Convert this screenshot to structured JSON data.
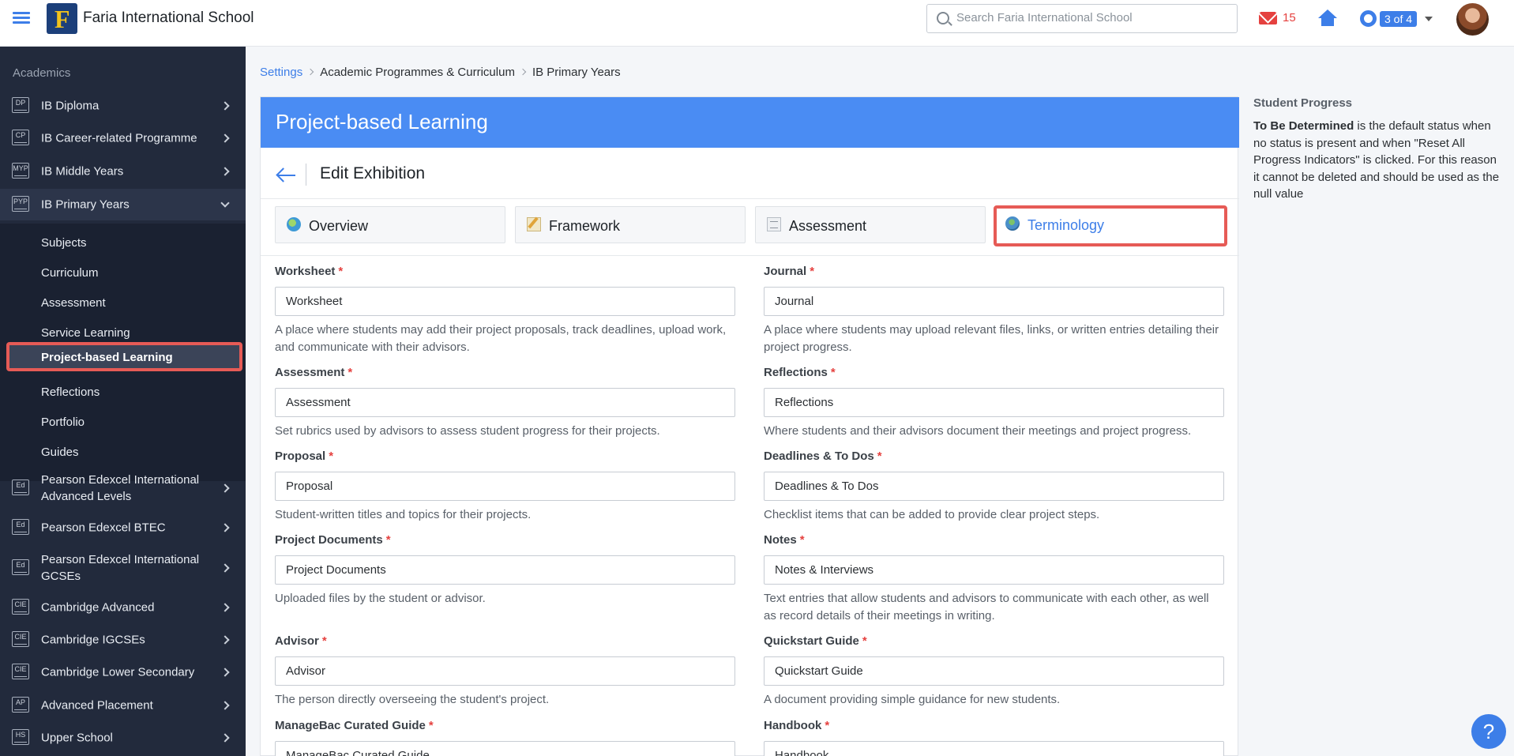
{
  "header": {
    "school_name": "Faria International School",
    "search_placeholder": "Search Faria International School",
    "mail_count": "15",
    "help_count": "3 of 4",
    "logo_letter": "F"
  },
  "sidebar": {
    "section": "Academics",
    "programmes_top": [
      {
        "abbr": "DP",
        "label": "IB Diploma"
      },
      {
        "abbr": "CP",
        "label": "IB Career-related Programme"
      },
      {
        "abbr": "MYP",
        "label": "IB Middle Years"
      },
      {
        "abbr": "PYP",
        "label": "IB Primary Years"
      }
    ],
    "sub_items": [
      "Subjects",
      "Curriculum",
      "Assessment",
      "Service Learning",
      "Project-based Learning",
      "Reflections",
      "Portfolio",
      "Guides"
    ],
    "programmes_bottom": [
      {
        "abbr": "Ed",
        "label": "Pearson Edexcel International Advanced Levels"
      },
      {
        "abbr": "Ed",
        "label": "Pearson Edexcel BTEC"
      },
      {
        "abbr": "Ed",
        "label": "Pearson Edexcel International GCSEs"
      },
      {
        "abbr": "CIE",
        "label": "Cambridge Advanced"
      },
      {
        "abbr": "CIE",
        "label": "Cambridge IGCSEs"
      },
      {
        "abbr": "CIE",
        "label": "Cambridge Lower Secondary"
      },
      {
        "abbr": "AP",
        "label": "Advanced Placement"
      },
      {
        "abbr": "HS",
        "label": "Upper School"
      }
    ]
  },
  "breadcrumb": [
    "Settings",
    "Academic Programmes & Curriculum",
    "IB Primary Years"
  ],
  "card": {
    "title": "Project-based Learning",
    "subtitle": "Edit Exhibition",
    "tabs": [
      "Overview",
      "Framework",
      "Assessment",
      "Terminology"
    ]
  },
  "fields": [
    {
      "label": "Worksheet",
      "value": "Worksheet",
      "help": "A place where students may add their project proposals, track deadlines, upload work, and communicate with their advisors."
    },
    {
      "label": "Journal",
      "value": "Journal",
      "help": "A place where students may upload relevant files, links, or written entries detailing their project progress."
    },
    {
      "label": "Assessment",
      "value": "Assessment",
      "help": "Set rubrics used by advisors to assess student progress for their projects."
    },
    {
      "label": "Reflections",
      "value": "Reflections",
      "help": "Where students and their advisors document their meetings and project progress."
    },
    {
      "label": "Proposal",
      "value": "Proposal",
      "help": "Student-written titles and topics for their projects."
    },
    {
      "label": "Deadlines & To Dos",
      "value": "Deadlines & To Dos",
      "help": "Checklist items that can be added to provide clear project steps."
    },
    {
      "label": "Project Documents",
      "value": "Project Documents",
      "help": "Uploaded files by the student or advisor."
    },
    {
      "label": "Notes",
      "value": "Notes & Interviews",
      "help": "Text entries that allow students and advisors to communicate with each other, as well as record details of their meetings in writing."
    },
    {
      "label": "Advisor",
      "value": "Advisor",
      "help": "The person directly overseeing the student's project."
    },
    {
      "label": "Quickstart Guide",
      "value": "Quickstart Guide",
      "help": "A document providing simple guidance for new students."
    },
    {
      "label": "ManageBac Curated Guide",
      "value": "ManageBac Curated Guide",
      "help": ""
    },
    {
      "label": "Handbook",
      "value": "Handbook",
      "help": ""
    }
  ],
  "right_panel": {
    "title": "Student Progress",
    "bold": "To Be Determined",
    "text": " is the default status when no status is present and when \"Reset All Progress Indicators\" is clicked. For this reason it cannot be deleted and should be used as the null value"
  },
  "help_button": "?"
}
